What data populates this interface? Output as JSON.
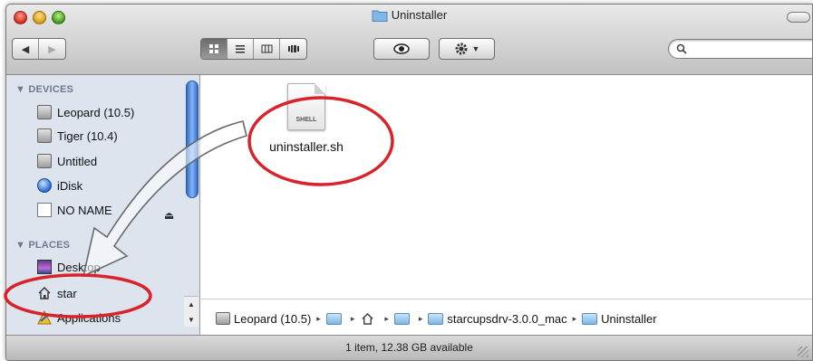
{
  "window": {
    "title": "Uninstaller"
  },
  "toolbar": {
    "back_label": "◀",
    "forward_label": "▶",
    "view_icons": [
      "icon-view-icon",
      "list-view-icon",
      "column-view-icon",
      "coverflow-view-icon"
    ],
    "search_placeholder": ""
  },
  "sidebar": {
    "devices_header": "▼ DEVICES",
    "places_header": "▼ PLACES",
    "devices": [
      {
        "label": "Leopard (10.5)",
        "icon": "hard-drive-icon"
      },
      {
        "label": "Tiger (10.4)",
        "icon": "hard-drive-icon"
      },
      {
        "label": "Untitled",
        "icon": "hard-drive-icon"
      },
      {
        "label": "iDisk",
        "icon": "idisk-icon"
      },
      {
        "label": "NO NAME",
        "icon": "blank-disk-icon"
      }
    ],
    "places": [
      {
        "label": "Desktop",
        "icon": "desktop-icon"
      },
      {
        "label": "star",
        "icon": "home-icon"
      },
      {
        "label": "Applications",
        "icon": "applications-icon"
      }
    ]
  },
  "content": {
    "file": {
      "name": "uninstaller.sh",
      "badge": "SHELL"
    }
  },
  "pathbar": {
    "items": [
      "Leopard (10.5)",
      "",
      "",
      "",
      "starcupsdrv-3.0.0_mac",
      "Uninstaller"
    ]
  },
  "status": {
    "text": "1 item, 12.38 GB available"
  },
  "colors": {
    "annotation": "#d8232a",
    "sidebar_bg": "#dde4ee"
  }
}
